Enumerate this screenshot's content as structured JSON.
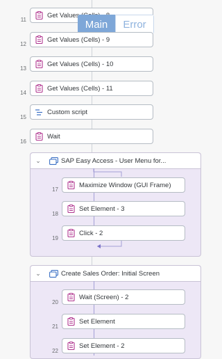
{
  "tabs": {
    "main": "Main",
    "error": "Error"
  },
  "steps": [
    {
      "num": "11",
      "label": "Get Values (Cells) - 8",
      "icon": "clipboard-icon"
    },
    {
      "num": "12",
      "label": "Get Values (Cells) - 9",
      "icon": "clipboard-icon"
    },
    {
      "num": "13",
      "label": "Get Values (Cells) - 10",
      "icon": "clipboard-icon"
    },
    {
      "num": "14",
      "label": "Get Values (Cells) - 11",
      "icon": "clipboard-icon"
    },
    {
      "num": "15",
      "label": "Custom script",
      "icon": "script-icon"
    },
    {
      "num": "16",
      "label": "Wait",
      "icon": "clipboard-icon"
    }
  ],
  "groups": [
    {
      "title": "SAP Easy Access  -  User Menu for...",
      "icon": "screen-icon",
      "steps": [
        {
          "num": "17",
          "label": "Maximize Window (GUI Frame)",
          "icon": "clipboard-icon"
        },
        {
          "num": "18",
          "label": "Set Element - 3",
          "icon": "clipboard-icon"
        },
        {
          "num": "19",
          "label": "Click - 2",
          "icon": "clipboard-icon"
        }
      ]
    },
    {
      "title": "Create Sales Order: Initial Screen",
      "icon": "screen-icon",
      "steps": [
        {
          "num": "20",
          "label": "Wait (Screen) - 2",
          "icon": "clipboard-icon"
        },
        {
          "num": "21",
          "label": "Set Element",
          "icon": "clipboard-icon"
        },
        {
          "num": "22",
          "label": "Set Element - 2",
          "icon": "clipboard-icon"
        }
      ]
    }
  ],
  "colors": {
    "accent": "#7ea7d8",
    "group_bg": "#ede7f6",
    "icon_magenta": "#b0358f",
    "script_blue": "#3a6fc4"
  }
}
